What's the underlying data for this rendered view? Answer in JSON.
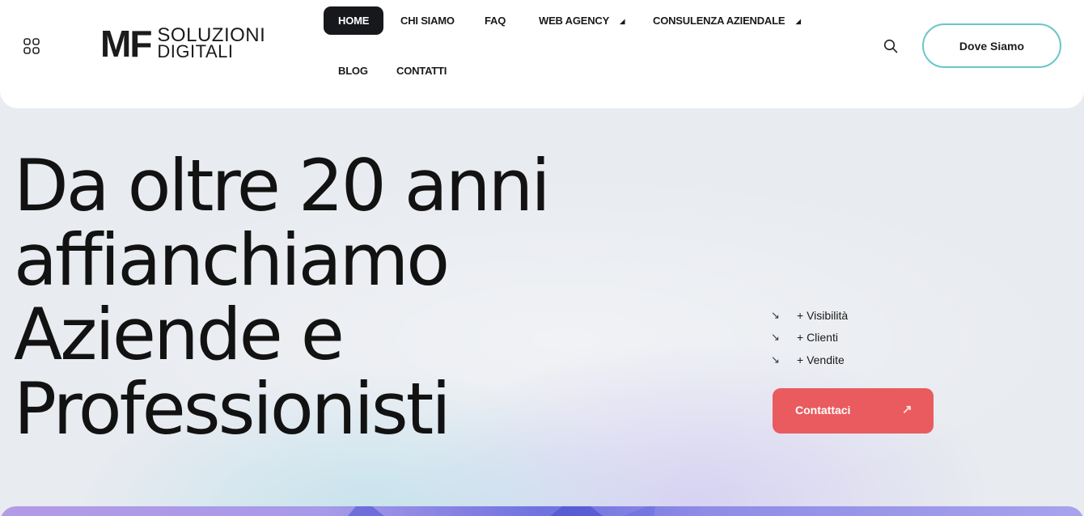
{
  "header": {
    "logo": {
      "mark": "MF",
      "line1": "SOLUZIONI",
      "line2": "DIGITALI"
    },
    "nav": [
      {
        "label": "HOME",
        "active": true
      },
      {
        "label": "CHI SIAMO"
      },
      {
        "label": "FAQ"
      },
      {
        "label": "WEB AGENCY",
        "has_submenu": true
      },
      {
        "label": "CONSULENZA AZIENDALE",
        "has_submenu": true
      },
      {
        "label": "BLOG"
      },
      {
        "label": "CONTATTI"
      }
    ],
    "cta_label": "Dove Siamo",
    "icons": {
      "menu": "grid-icon",
      "search": "search-icon",
      "caret": "caret-down-icon"
    },
    "colors": {
      "active_nav_bg": "#16181c",
      "cta_border": "#68c6c9"
    }
  },
  "hero": {
    "title_lines": [
      "Da oltre 20 anni",
      "affianchiamo",
      "Aziende e",
      "Professionisti"
    ],
    "bullets": [
      "+ Visibilità",
      "+ Clienti",
      "+ Vendite"
    ],
    "bullet_icon": "arrow-down-right-icon",
    "contact_label": "Contattaci",
    "contact_icon": "arrow-up-right-icon",
    "colors": {
      "contact_bg": "#e95b5e"
    }
  }
}
